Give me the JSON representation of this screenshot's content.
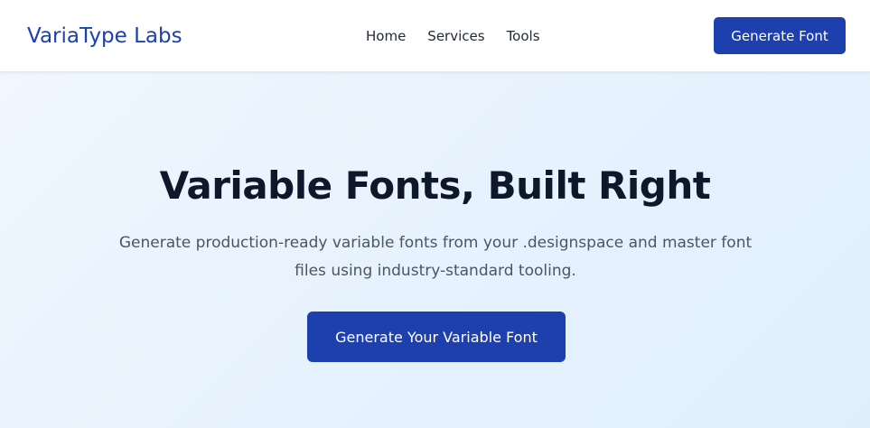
{
  "header": {
    "logo": "VariaType Labs",
    "nav": [
      "Home",
      "Services",
      "Tools"
    ],
    "cta_label": "Generate Font"
  },
  "hero": {
    "title": "Variable Fonts, Built Right",
    "subtitle": "Generate production-ready variable fonts from your .designspace and master font files using industry-standard tooling.",
    "cta_label": "Generate Your Variable Font"
  },
  "colors": {
    "brand": "#1e40af",
    "heading": "#0f172a",
    "body_text": "#4b5563",
    "hero_bg": "#e6f2fd"
  }
}
